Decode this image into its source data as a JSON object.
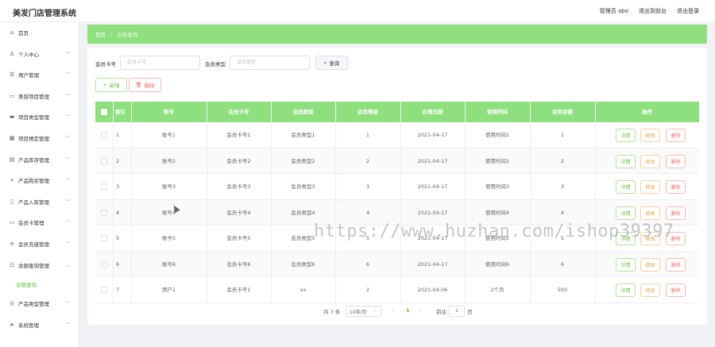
{
  "header": {
    "title": "美发门店管理系统",
    "user_label": "管理员 abo",
    "to_frontend": "退出到前台",
    "logout": "退出登录"
  },
  "sidebar": {
    "items": [
      {
        "label": "首页",
        "icon": "home-icon"
      },
      {
        "label": "个人中心",
        "icon": "user-icon"
      },
      {
        "label": "用户管理",
        "icon": "users-icon"
      },
      {
        "label": "美容项目管理",
        "icon": "chat-icon"
      },
      {
        "label": "项目类型管理",
        "icon": "folder-icon"
      },
      {
        "label": "项目预定管理",
        "icon": "grid-icon"
      },
      {
        "label": "产品库存管理",
        "icon": "box-icon"
      },
      {
        "label": "产品购买管理",
        "icon": "bracket-icon"
      },
      {
        "label": "产品入库管理",
        "icon": "phone-icon"
      },
      {
        "label": "会员卡管理",
        "icon": "card-icon"
      },
      {
        "label": "会员充值管理",
        "icon": "list-icon"
      },
      {
        "label": "余额查询管理",
        "icon": "chart-icon"
      },
      {
        "label": "产品类型管理",
        "icon": "circle-icon"
      },
      {
        "label": "系统管理",
        "icon": "send-icon"
      }
    ],
    "active_sub": "余额查询"
  },
  "breadcrumb": {
    "home": "首页",
    "separator": "/",
    "current": "余额查询"
  },
  "search": {
    "card_label": "会员卡号",
    "card_placeholder": "会员卡号",
    "type_label": "会员类型",
    "type_placeholder": "会员类型",
    "query_button": "查询"
  },
  "toolbar": {
    "add_label": "新增",
    "delete_label": "删除"
  },
  "table": {
    "headers": [
      "索引",
      "账号",
      "会员卡号",
      "会员类型",
      "会员等级",
      "办理日期",
      "使用时间",
      "会员余额",
      "操作"
    ],
    "rows": [
      [
        "1",
        "账号1",
        "会员卡号1",
        "会员类型1",
        "1",
        "2021-04-17",
        "使用时间1",
        "1"
      ],
      [
        "2",
        "账号2",
        "会员卡号2",
        "会员类型2",
        "2",
        "2021-04-17",
        "使用时间2",
        "2"
      ],
      [
        "3",
        "账号3",
        "会员卡号3",
        "会员类型3",
        "3",
        "2021-04-17",
        "使用时间3",
        "3"
      ],
      [
        "4",
        "账号4",
        "会员卡号4",
        "会员类型4",
        "4",
        "2021-04-17",
        "使用时间4",
        "4"
      ],
      [
        "5",
        "账号5",
        "会员卡号5",
        "会员类型5",
        "5",
        "2021-04-17",
        "使用时间5",
        "5"
      ],
      [
        "6",
        "账号6",
        "会员卡号6",
        "会员类型6",
        "6",
        "2021-04-17",
        "使用时间6",
        "6"
      ],
      [
        "7",
        "用户1",
        "会员卡号1",
        "xx",
        "2",
        "2021-04-06",
        "2个月",
        "500"
      ]
    ],
    "actions": {
      "detail": "详情",
      "edit": "修改",
      "delete": "删除"
    }
  },
  "pagination": {
    "total": "共 7 条",
    "page_size": "10条/页",
    "current_page": "1",
    "goto_label": "前往",
    "goto_value": "1",
    "page_unit": "页"
  },
  "watermark": "https://www.huzhan.com/ishop39397",
  "colors": {
    "accent": "#8ee07f",
    "success": "#67c23a",
    "warning": "#e6a23c",
    "danger": "#f56c6c"
  }
}
